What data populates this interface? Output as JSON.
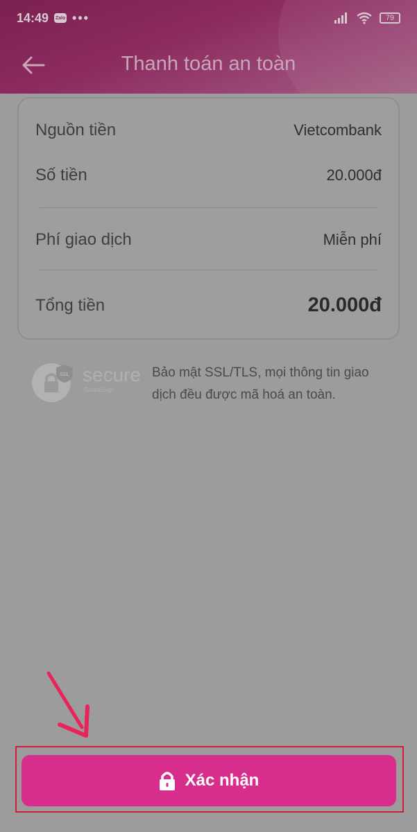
{
  "status_bar": {
    "time": "14:49",
    "app_badge": "Zalo",
    "more": "•••",
    "battery": "79"
  },
  "header": {
    "title": "Thanh toán an toàn"
  },
  "payment": {
    "source_label": "Nguồn tiền",
    "source_value": "Vietcombank",
    "amount_label": "Số tiền",
    "amount_value": "20.000đ",
    "fee_label": "Phí giao dịch",
    "fee_value": "Miễn phí",
    "total_label": "Tổng tiền",
    "total_value": "20.000đ"
  },
  "security": {
    "logo_text": "secure",
    "logo_sub": "GlobalSign",
    "logo_badge": "SSL",
    "message": "Bảo mật SSL/TLS, mọi thông tin giao dịch đều được mã hoá an toàn."
  },
  "confirm": {
    "label": "Xác nhận"
  },
  "colors": {
    "accent": "#d62e8a",
    "annotation": "#e8245a"
  }
}
